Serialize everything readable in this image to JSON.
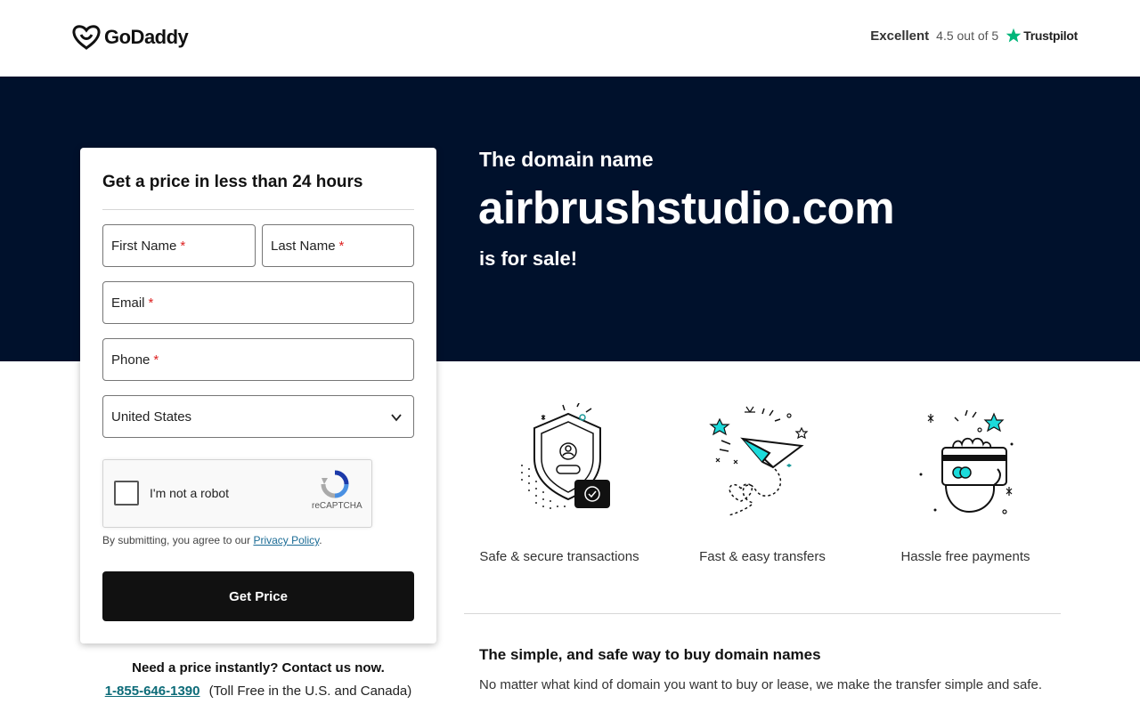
{
  "header": {
    "brand": "GoDaddy",
    "trust_label": "Excellent",
    "trust_rating": "4.5 out of 5",
    "trust_brand": "Trustpilot"
  },
  "hero": {
    "intro": "The domain name",
    "domain": "airbrushstudio.com",
    "status": "is for sale!"
  },
  "form": {
    "title": "Get a price in less than 24 hours",
    "first_name": "First Name",
    "last_name": "Last Name",
    "email": "Email",
    "phone": "Phone",
    "required_mark": "*",
    "country": "United States",
    "captcha_label": "I'm not a robot",
    "captcha_brand": "reCAPTCHA",
    "consent_text": "By submitting, you agree to our",
    "consent_link": "Privacy Policy",
    "consent_end": ".",
    "submit": "Get Price"
  },
  "contact": {
    "heading": "Need a price instantly? Contact us now.",
    "phone": "1-855-646-1390",
    "note": "(Toll Free in the U.S. and Canada)"
  },
  "features": [
    {
      "icon": "shield-user-icon",
      "label": "Safe & secure transactions"
    },
    {
      "icon": "paper-plane-icon",
      "label": "Fast & easy transfers"
    },
    {
      "icon": "card-hand-icon",
      "label": "Hassle free payments"
    }
  ],
  "info": {
    "title": "The simple, and safe way to buy domain names",
    "body": "No matter what kind of domain you want to buy or lease, we make the transfer simple and safe."
  },
  "colors": {
    "hero_bg": "#00112c",
    "accent_teal": "#1bdbdb",
    "button": "#111111",
    "trustpilot_star": "#00b67a",
    "required": "#dd2222"
  }
}
